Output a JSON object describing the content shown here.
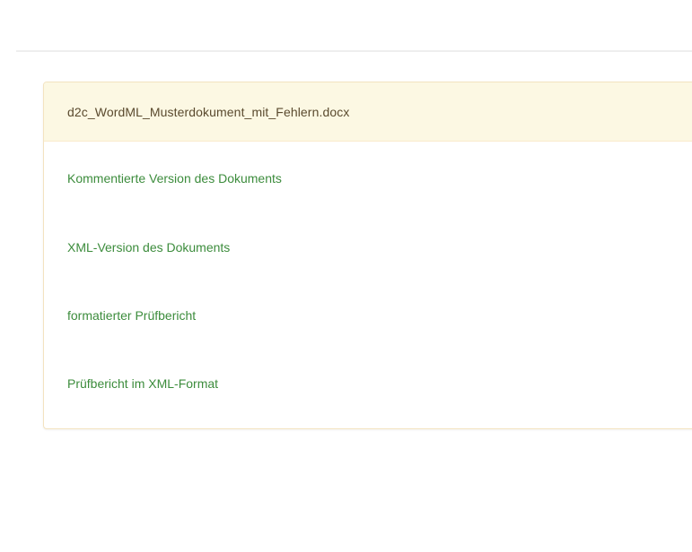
{
  "panel": {
    "heading": "d2c_WordML_Musterdokument_mit_Fehlern.docx",
    "links": [
      {
        "label": "Kommentierte Version des Dokuments"
      },
      {
        "label": "XML-Version des Dokuments"
      },
      {
        "label": "formatierter Prüfbericht"
      },
      {
        "label": "Prüfbericht im XML-Format"
      }
    ]
  },
  "colors": {
    "heading_bg": "#fcf8e3",
    "link": "#3c8c3c",
    "border": "#faebcc"
  }
}
